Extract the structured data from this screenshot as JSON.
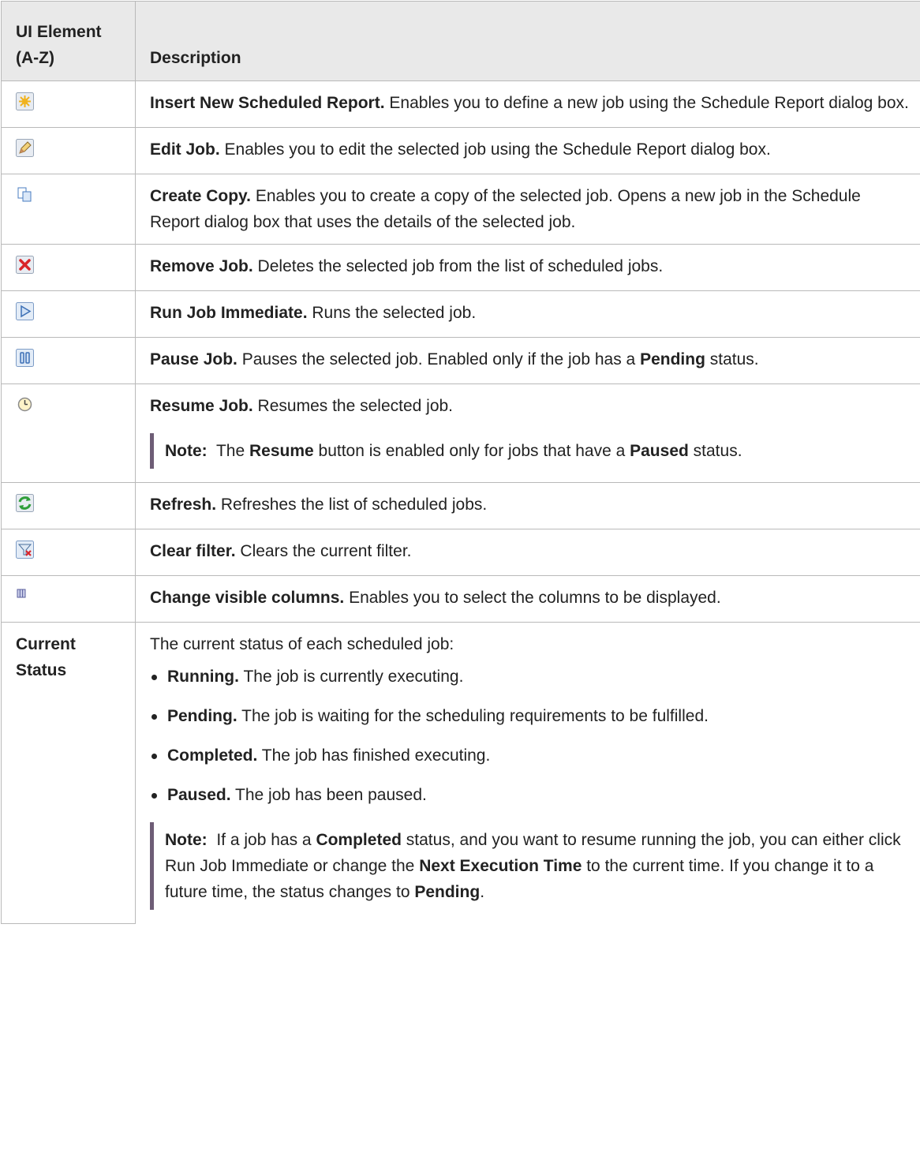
{
  "header": {
    "col1": "UI Element (A-Z)",
    "col2": "Description"
  },
  "rows": [
    {
      "icon": "insert-new-icon",
      "title": "Insert New Scheduled Report.",
      "text": " Enables you to define a new job using the Schedule Report dialog box."
    },
    {
      "icon": "edit-pencil-icon",
      "title": "Edit Job.",
      "text": " Enables you to edit the selected job using the Schedule Report dialog box."
    },
    {
      "icon": "copy-icon",
      "title": "Create Copy.",
      "text": " Enables you to create a copy of the selected job. Opens a new job in the Schedule Report dialog box that uses the details of the selected job."
    },
    {
      "icon": "remove-x-icon",
      "title": "Remove Job.",
      "text": " Deletes the selected job from the list of scheduled jobs."
    },
    {
      "icon": "play-icon",
      "title": "Run Job Immediate.",
      "text": " Runs the selected job."
    },
    {
      "icon": "pause-icon",
      "title": "Pause Job.",
      "text": " Pauses the selected job. Enabled only if the job has a ",
      "bold2": "Pending",
      "text2": " status."
    },
    {
      "icon": "clock-icon",
      "title": "Resume Job.",
      "text": " Resumes the selected job.",
      "note": {
        "label": "Note:",
        "t1": "  The ",
        "b1": "Resume",
        "t2": " button is enabled only for jobs that have a ",
        "b2": "Paused",
        "t3": " status."
      }
    },
    {
      "icon": "refresh-icon",
      "title": "Refresh.",
      "text": " Refreshes the list of scheduled jobs."
    },
    {
      "icon": "clear-filter-icon",
      "title": "Clear filter.",
      "text": " Clears the current filter."
    },
    {
      "icon": "columns-icon",
      "title": "Change visible columns.",
      "text": " Enables you to select the columns to be displayed."
    }
  ],
  "status_row": {
    "element": "Current Status",
    "intro": "The current status of each scheduled job:",
    "items": [
      {
        "label": "Running.",
        "text": " The job is currently executing."
      },
      {
        "label": "Pending.",
        "text": " The job is waiting for the scheduling requirements to be fulfilled."
      },
      {
        "label": "Completed.",
        "text": " The job has finished executing."
      },
      {
        "label": "Paused.",
        "text": " The job has been paused."
      }
    ],
    "note": {
      "label": "Note:",
      "t1": "  If a job has a ",
      "b1": "Completed",
      "t2": " status, and you want to resume running the job, you can either click Run Job Immediate or change the ",
      "b2": "Next Execution Time",
      "t3": " to the current time. If you change it to a future time, the status changes to ",
      "b3": "Pending",
      "t4": "."
    }
  }
}
